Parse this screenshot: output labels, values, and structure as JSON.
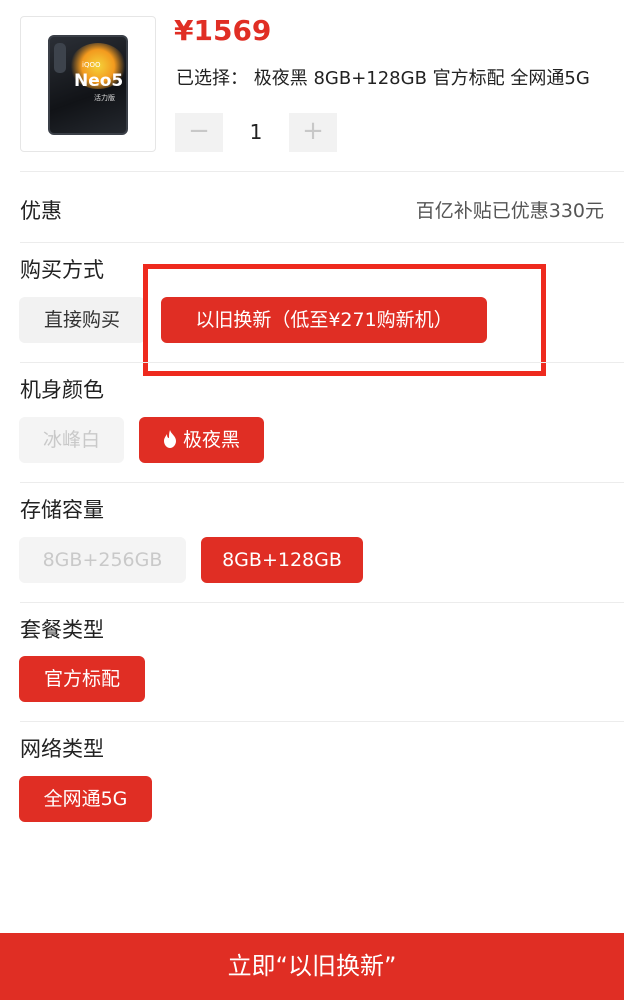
{
  "product": {
    "image_name": "phone-product-image",
    "phone_brand": "iQOO",
    "phone_model": "Neo5",
    "phone_sub": "活力版",
    "price": "¥1569",
    "selected_text": "已选择： 极夜黑 8GB+128GB 官方标配 全网通5G",
    "quantity": "1",
    "minus_symbol": "−",
    "plus_symbol": "+"
  },
  "promo": {
    "label": "优惠",
    "value": "百亿补贴已优惠330元"
  },
  "purchase": {
    "label": "购买方式",
    "options": [
      {
        "label": "直接购买",
        "state": "default"
      },
      {
        "label": "以旧换新（低至¥271购新机）",
        "state": "selected"
      }
    ]
  },
  "color": {
    "label": "机身颜色",
    "options": [
      {
        "label": "冰峰白",
        "state": "disabled"
      },
      {
        "label": "极夜黑",
        "state": "selected",
        "icon": "flame-icon"
      }
    ]
  },
  "storage": {
    "label": "存储容量",
    "options": [
      {
        "label": "8GB+256GB",
        "state": "disabled"
      },
      {
        "label": "8GB+128GB",
        "state": "selected"
      }
    ]
  },
  "package": {
    "label": "套餐类型",
    "options": [
      {
        "label": "官方标配",
        "state": "selected"
      }
    ]
  },
  "network": {
    "label": "网络类型",
    "options": [
      {
        "label": "全网通5G",
        "state": "selected"
      }
    ]
  },
  "cta": {
    "label": "立即“以旧换新”"
  },
  "colors": {
    "accent": "#e02e24",
    "highlight_border": "#ee2a1e",
    "chip_gray": "#f2f2f2"
  }
}
